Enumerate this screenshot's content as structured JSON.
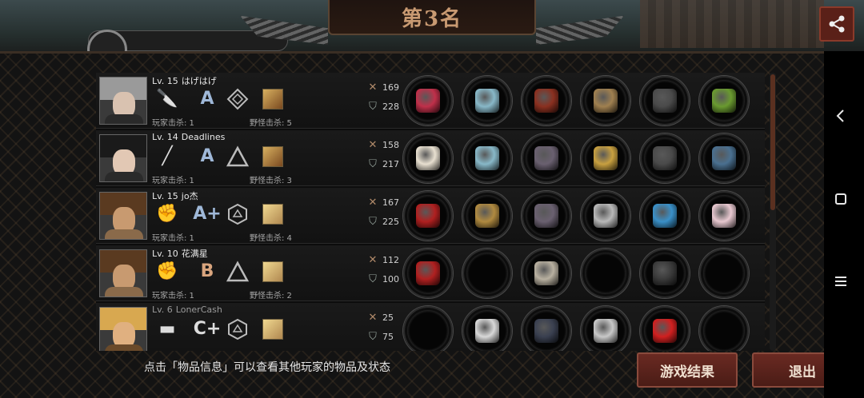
{
  "header": {
    "title": "第3名"
  },
  "players": [
    {
      "level": "Lv. 15",
      "name": "はげはげ",
      "weapon_icon": "knife-icon",
      "grade": "A",
      "tier_icon": "diamond-rank-icon",
      "monster_icon": "monster-portrait-icon",
      "player_kills_label": "玩家击杀: 1",
      "monster_kills_label": "野怪击杀: 5",
      "attack": "169",
      "defense": "228",
      "skin": "#d9c2b0",
      "hair": "#9a9a9a",
      "body": "#2a2a2a",
      "items": [
        "#c0304a",
        "#88b8c8",
        "#8a3020",
        "#a08050",
        "#4a4a4a",
        "#6a9a30"
      ]
    },
    {
      "level": "Lv. 14",
      "name": "Deadlines",
      "weapon_icon": "bat-icon",
      "grade": "A",
      "tier_icon": "triangle-rank-icon",
      "monster_icon": "monster-portrait-icon",
      "player_kills_label": "玩家击杀: 1",
      "monster_kills_label": "野怪击杀: 3",
      "attack": "158",
      "defense": "217",
      "skin": "#e2c8b4",
      "hair": "#1a1a1a",
      "body": "#2a2a2a",
      "items": [
        "#e8e0d0",
        "#88b8c8",
        "#6a6070",
        "#c8a040",
        "#4a4a4a",
        "#4a7090"
      ]
    },
    {
      "level": "Lv. 15",
      "name": "jo杰",
      "weapon_icon": "fist-icon",
      "grade": "A+",
      "tier_icon": "hexagon-rank-icon",
      "monster_icon": "monster-portrait-icon",
      "player_kills_label": "玩家击杀: 1",
      "monster_kills_label": "野怪击杀: 4",
      "attack": "167",
      "defense": "225",
      "skin": "#c89a70",
      "hair": "#5a3a20",
      "body": "#8a6a4a",
      "items": [
        "#b02020",
        "#b08a40",
        "#6a6070",
        "#b8b8b8",
        "#3a90c8",
        "#e8c8d0"
      ]
    },
    {
      "level": "Lv. 10",
      "name": "花满星",
      "weapon_icon": "fist-icon",
      "grade": "B",
      "tier_icon": "triangle-rank-icon",
      "monster_icon": "monster-portrait-icon",
      "player_kills_label": "玩家击杀: 1",
      "monster_kills_label": "野怪击杀: 2",
      "attack": "112",
      "defense": "100",
      "skin": "#c89a70",
      "hair": "#5a3a20",
      "body": "#8a6a4a",
      "items": [
        "#b02020",
        "",
        "#b8b0a0",
        "",
        "#3a3a3a",
        ""
      ]
    },
    {
      "level": "Lv. 6",
      "name": "LonerCash",
      "weapon_icon": "pistol-icon",
      "grade": "C+",
      "tier_icon": "hexagon-rank-icon",
      "monster_icon": "monster-portrait-icon",
      "player_kills_label": "",
      "monster_kills_label": "",
      "attack": "25",
      "defense": "75",
      "skin": "#e0b080",
      "hair": "#d8a850",
      "body": "#6a4a2a",
      "items": [
        "",
        "#d8d8d8",
        "#3a4050",
        "#c8c8c8",
        "#d02020",
        ""
      ]
    }
  ],
  "footer": {
    "hint": "点击「物品信息」可以查看其他玩家的物品及状态",
    "result_button": "游戏结果",
    "exit_button": "退出"
  },
  "colors": {
    "accent": "#6a2a22",
    "title": "#c99a72"
  }
}
